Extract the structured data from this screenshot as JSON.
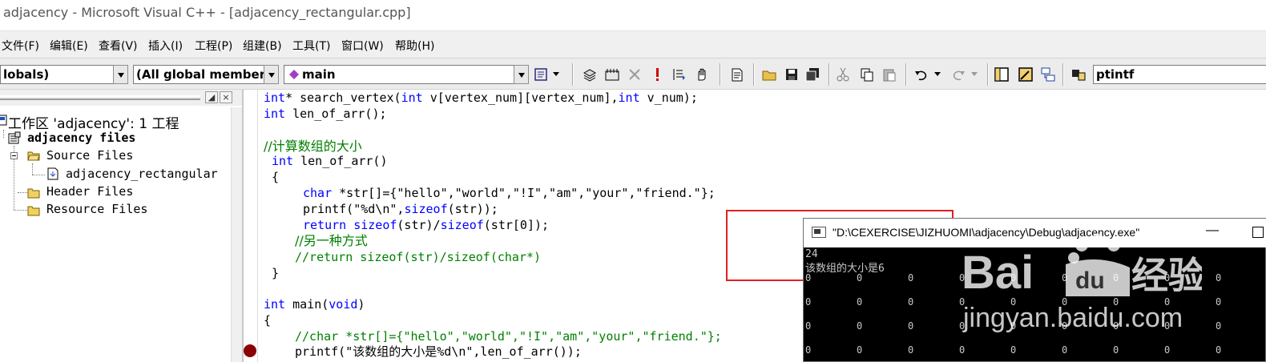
{
  "window": {
    "title": "adjacency - Microsoft Visual C++ - [adjacency_rectangular.cpp]"
  },
  "menu": [
    "文件(F)",
    "编辑(E)",
    "查看(V)",
    "插入(I)",
    "工程(P)",
    "组建(B)",
    "工具(T)",
    "窗口(W)",
    "帮助(H)"
  ],
  "toolbar": {
    "scope_combo": "lobals)",
    "members_combo": "(All global members",
    "function_combo": "main",
    "find_text": "ptintf",
    "icons": [
      "wizard-bar-icon",
      "compile-icon",
      "build-icon",
      "stop-build-icon",
      "execute-icon",
      "go-icon",
      "insert-remove-breakpoint-icon",
      "new-text-file-icon",
      "open-icon",
      "save-icon",
      "save-all-icon",
      "cut-icon",
      "copy-icon",
      "paste-icon",
      "undo-icon",
      "redo-icon",
      "workspace-icon",
      "output-icon",
      "window-list-icon",
      "find-in-files-icon"
    ]
  },
  "workspace": {
    "root": "工作区 'adjacency': 1 工程",
    "project": "adjacency files",
    "source_folder": "Source Files",
    "source_file": "adjacency_rectangular",
    "header_folder": "Header Files",
    "resource_folder": "Resource Files"
  },
  "code": {
    "l1": [
      [
        "kw",
        "int"
      ],
      [
        "t",
        "* search_vertex("
      ],
      [
        "kw",
        "int"
      ],
      [
        "t",
        " v[vertex_num][vertex_num],"
      ],
      [
        "kw",
        "int"
      ],
      [
        "t",
        " v_num);"
      ]
    ],
    "l2": [
      [
        "kw",
        "int"
      ],
      [
        "t",
        " len_of_arr();"
      ]
    ],
    "l3": [
      [
        "cm",
        "//计算数组的大小"
      ]
    ],
    "l4": [
      [
        "kw",
        "int"
      ],
      [
        "t",
        " len_of_arr()"
      ]
    ],
    "l5": [
      [
        "t",
        "{"
      ]
    ],
    "l6": [
      [
        "kw",
        "char"
      ],
      [
        "t",
        " *str[]={\"hello\",\"world\",\"!I\",\"am\",\"your\",\"friend.\"};"
      ]
    ],
    "l7": [
      [
        "t",
        "printf(\"%d\\n\","
      ],
      [
        "kw",
        "sizeof"
      ],
      [
        "t",
        "(str));"
      ]
    ],
    "l8": [
      [
        "kw",
        "return"
      ],
      [
        "t",
        " "
      ],
      [
        "kw",
        "sizeof"
      ],
      [
        "t",
        "(str)/"
      ],
      [
        "kw",
        "sizeof"
      ],
      [
        "t",
        "(str[0]);"
      ]
    ],
    "l9": [
      [
        "cm",
        "//另一种方式"
      ]
    ],
    "l10": [
      [
        "cm",
        "//return sizeof(str)/sizeof(char*)"
      ]
    ],
    "l11": [
      [
        "t",
        "}"
      ]
    ],
    "l12": [
      [
        "kw",
        "int"
      ],
      [
        "t",
        " main("
      ],
      [
        "kw",
        "void"
      ],
      [
        "t",
        ")"
      ]
    ],
    "l13": [
      [
        "t",
        "{"
      ]
    ],
    "l14": [
      [
        "cm",
        "//char *str[]={\"hello\",\"world\",\"!I\",\"am\",\"your\",\"friend.\"};"
      ]
    ],
    "l15": [
      [
        "t",
        "printf(\"该数组的大小是%d\\n\",len_of_arr());"
      ]
    ]
  },
  "console": {
    "title": "\"D:\\CEXERCISE\\JIZHUOMI\\adjacency\\Debug\\adjacency.exe\"",
    "minimize": "—",
    "line1": "24",
    "line2": "该数组的大小是6",
    "grid_value": "0"
  },
  "watermark": {
    "brand_latin": "Bai",
    "brand_du": "du",
    "brand_cn": "经验",
    "url": "jingyan.baidu.com"
  }
}
